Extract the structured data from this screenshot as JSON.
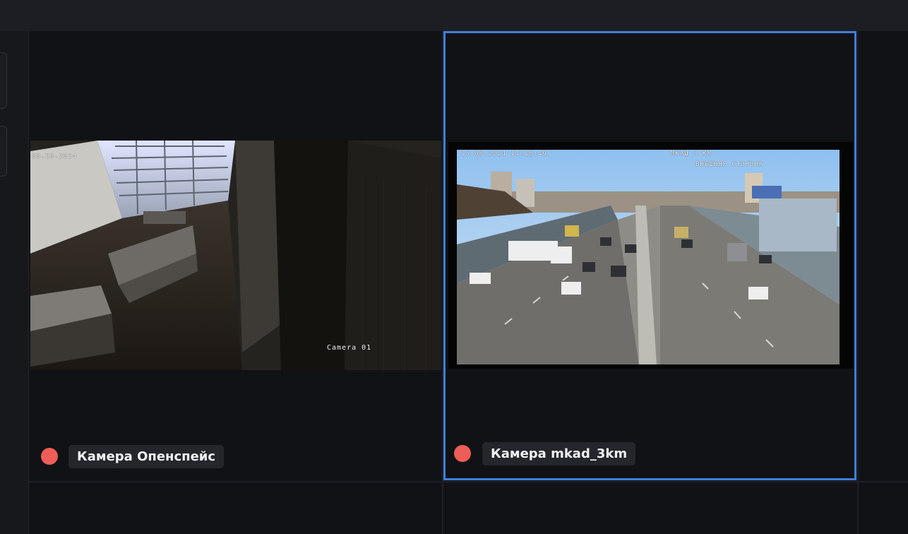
{
  "cameras": [
    {
      "name": "Камера Опенспейс",
      "timestamp": "08-20-2024",
      "overlay_name": "Camera 01",
      "status_color": "#ef5d57",
      "selected": false
    },
    {
      "name": "Камера mkad_3km",
      "timestamp": "15.08.2024 14:18:49",
      "overlay_top": "МКАД 3 КМ",
      "overlay_sub": "ВНЕШНЯЯ СТОРОНА",
      "status_color": "#ef5d57",
      "selected": true
    }
  ],
  "colors": {
    "accent": "#3f7edb",
    "status_offline": "#ef5d57",
    "background": "#111216"
  }
}
